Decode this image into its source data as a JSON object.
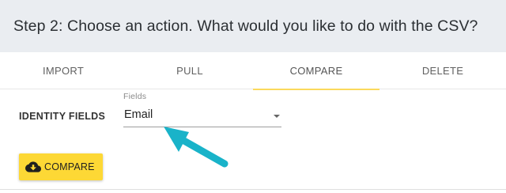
{
  "header": {
    "title": "Step 2: Choose an action. What would you like to do with the CSV?"
  },
  "tabs": [
    {
      "label": "IMPORT",
      "active": false
    },
    {
      "label": "PULL",
      "active": false
    },
    {
      "label": "COMPARE",
      "active": true
    },
    {
      "label": "DELETE",
      "active": false
    }
  ],
  "form": {
    "identity_label": "IDENTITY FIELDS",
    "fields_caption": "Fields",
    "fields_value": "Email"
  },
  "action_button": {
    "label": "COMPARE",
    "icon": "cloud-download-icon"
  },
  "colors": {
    "accent": "#fdd835",
    "tab_indicator": "#fbd95c",
    "arrow": "#19b3c9",
    "header_bg": "#eaedf1"
  }
}
